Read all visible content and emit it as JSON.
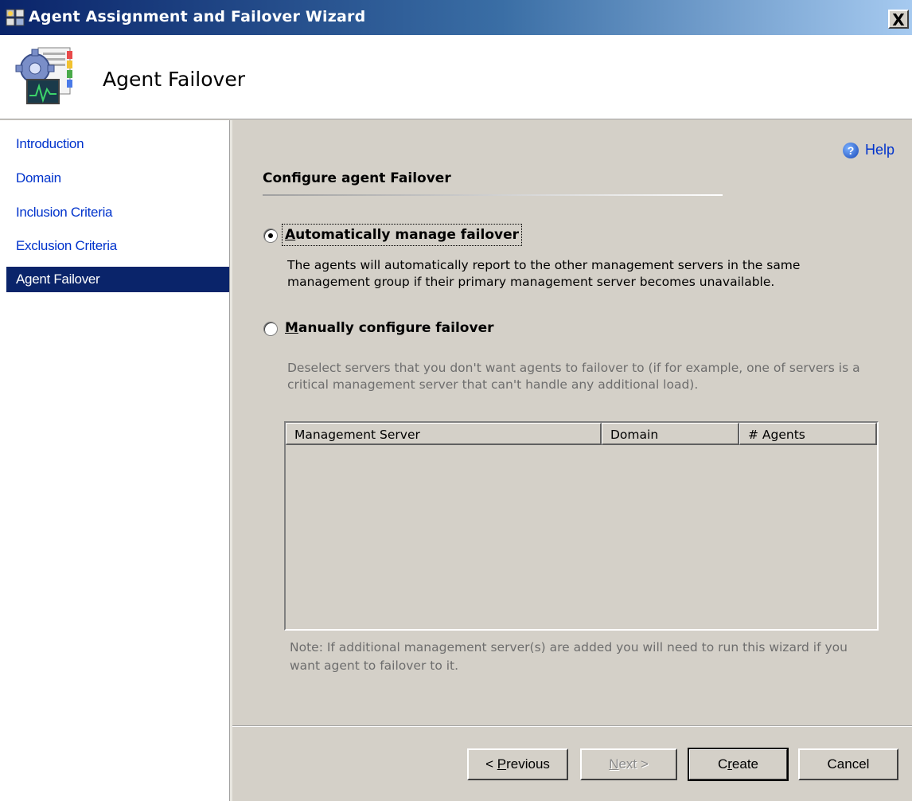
{
  "window": {
    "title": "Agent Assignment and Failover Wizard",
    "close_label": "X"
  },
  "header": {
    "page_title": "Agent Failover"
  },
  "nav": {
    "items": [
      {
        "label": "Introduction",
        "selected": false
      },
      {
        "label": "Domain",
        "selected": false
      },
      {
        "label": "Inclusion Criteria",
        "selected": false
      },
      {
        "label": "Exclusion Criteria",
        "selected": false
      },
      {
        "label": "Agent Failover",
        "selected": true
      }
    ]
  },
  "help": {
    "label": "Help",
    "icon": "help-icon"
  },
  "main": {
    "section_title": "Configure agent Failover",
    "auto_option": {
      "label_first": "A",
      "label_rest": "utomatically manage failover",
      "checked": true,
      "description": "The agents will automatically report to the other management servers in the same management group if their primary management server becomes unavailable."
    },
    "manual_option": {
      "label_first": "M",
      "label_rest": "anually configure failover",
      "checked": false,
      "description": "Deselect servers that you don't want agents to failover to (if for example, one of servers is a critical management server that can't handle any additional load)."
    },
    "table": {
      "columns": [
        "Management Server",
        "Domain",
        "# Agents"
      ],
      "rows": []
    },
    "note": "Note: If additional management server(s) are added you will need to run this wizard if you want agent to failover to it."
  },
  "buttons": {
    "previous": {
      "prefix": "< ",
      "accel": "P",
      "rest": "revious"
    },
    "next": {
      "accel": "N",
      "rest": "ext >"
    },
    "create": {
      "prefix": "C",
      "accel": "r",
      "rest": "eate"
    },
    "cancel": {
      "label": "Cancel"
    }
  }
}
